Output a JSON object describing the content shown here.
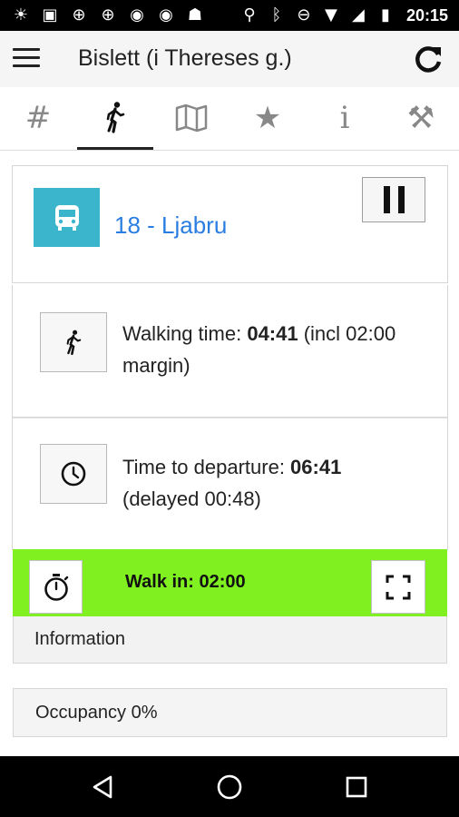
{
  "status_bar": {
    "time": "20:15",
    "left_icons": [
      "brightness-icon",
      "image-icon",
      "crosshair-icon",
      "crosshair-icon",
      "stack-icon",
      "stack-icon",
      "android-icon"
    ],
    "right_icons": [
      "location-icon",
      "bluetooth-icon",
      "do-not-disturb-icon",
      "wifi-icon",
      "signal-icon",
      "battery-icon"
    ]
  },
  "app_bar": {
    "title": "Bislett (i Thereses g.)",
    "left_icon": "menu-icon",
    "right_icon": "refresh-icon"
  },
  "tabs": [
    {
      "icon": "hash-icon",
      "glyph": "#",
      "active": false
    },
    {
      "icon": "walk-icon",
      "glyph": "",
      "active": true
    },
    {
      "icon": "map-icon",
      "glyph": "",
      "active": false
    },
    {
      "icon": "star-icon",
      "glyph": "★",
      "active": false
    },
    {
      "icon": "info-icon",
      "glyph": "i",
      "active": false
    },
    {
      "icon": "tools-icon",
      "glyph": "⚒",
      "active": false
    }
  ],
  "route": {
    "name": "18 - Ljabru",
    "icon": "tram-icon",
    "icon_color": "#3bb5cc",
    "name_color": "#2a7de1"
  },
  "walking": {
    "label": "Walking time: ",
    "value": "04:41",
    "suffix": " (incl 02:00 margin)"
  },
  "departure": {
    "label": "Time to departure: ",
    "value": "06:41",
    "suffix": " (delayed 00:48)"
  },
  "walk_in": {
    "text": "Walk in: 02:00",
    "color": "#80f020"
  },
  "information": {
    "label": "Information"
  },
  "occupancy": {
    "label": "Occupancy 0%"
  },
  "nav_bar": {
    "buttons": [
      "back-icon",
      "home-icon",
      "recents-icon"
    ]
  }
}
